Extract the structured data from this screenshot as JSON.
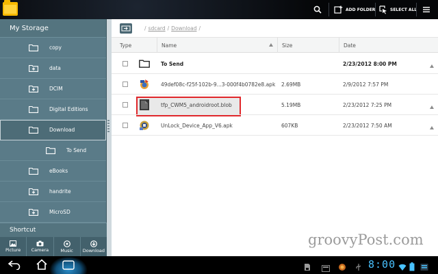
{
  "toolbar": {
    "add_folder_label": "ADD FOLDER",
    "select_all_label": "SELECT ALL"
  },
  "sidebar": {
    "header": "My Storage",
    "items": [
      {
        "label": "copy",
        "icon": "folder-icon"
      },
      {
        "label": "data",
        "icon": "folder-plus-icon"
      },
      {
        "label": "DCIM",
        "icon": "folder-plus-icon"
      },
      {
        "label": "Digital Editions",
        "icon": "folder-icon"
      },
      {
        "label": "Download",
        "icon": "folder-icon",
        "selected": true
      },
      {
        "label": "To Send",
        "icon": "folder-icon",
        "sub": true
      },
      {
        "label": "eBooks",
        "icon": "folder-icon"
      },
      {
        "label": "handrite",
        "icon": "folder-plus-icon"
      },
      {
        "label": "MicroSD",
        "icon": "folder-plus-icon"
      }
    ],
    "shortcut": "Shortcut",
    "tabs": [
      "Picture",
      "Camera",
      "Music",
      "Download"
    ]
  },
  "path": {
    "sep_start": "/",
    "sdcard": "sdcard",
    "sep": "/",
    "download": "Download",
    "sep_end": "/"
  },
  "table": {
    "columns": [
      "Type",
      "Name",
      "Size",
      "Date"
    ],
    "rows": [
      {
        "name": "To Send",
        "size": "",
        "date": "2/23/2012 8:00 PM",
        "bold": true,
        "kind": "folder"
      },
      {
        "name": "49def08c-f25f-102b-9...3-000f4b0782e8.apk",
        "size": "2.69MB",
        "date": "2/9/2012 7:57 PM",
        "kind": "apk"
      },
      {
        "name": "tfp_CWM5_androidroot.blob",
        "size": "5.19MB",
        "date": "2/23/2012 7:25 PM",
        "kind": "blob"
      },
      {
        "name": "UnLock_Device_App_V6.apk",
        "size": "607KB",
        "date": "2/23/2012 7:50 AM",
        "kind": "apk2"
      }
    ]
  },
  "watermark": "groovyPost.com",
  "system": {
    "clock": "8:00"
  },
  "colors": {
    "sidebar": "#5b7d8a",
    "highlight_border": "#e0262a",
    "clock": "#49c2ff"
  }
}
